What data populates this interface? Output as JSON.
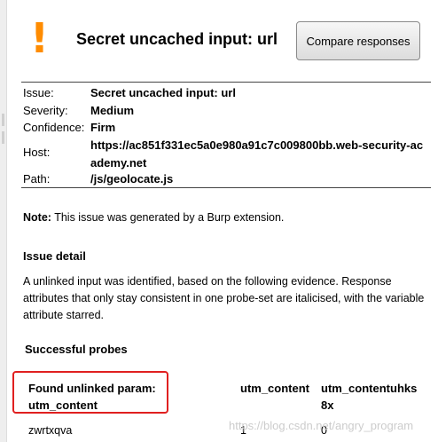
{
  "header": {
    "icon": "exclamation-warning-icon",
    "icon_glyph": "!",
    "icon_color": "#ff8c00",
    "title": "Secret uncached input: url",
    "compare_button": "Compare responses"
  },
  "issue_meta": [
    {
      "label": "Issue:",
      "value": "Secret uncached input: url"
    },
    {
      "label": "Severity:",
      "value": "Medium"
    },
    {
      "label": "Confidence:",
      "value": "Firm"
    },
    {
      "label": "Host:",
      "value": "https://ac851f331ec5a0e980a91c7c009800bb.web-security-academy.net"
    },
    {
      "label": "Path:",
      "value": "/js/geolocate.js"
    }
  ],
  "note": {
    "label": "Note:",
    "text": "This issue was generated by a Burp extension."
  },
  "issue_detail": {
    "heading": "Issue detail",
    "text": "A unlinked input was identified, based on the following evidence. Response attributes that only stay consistent in one probe-set are italicised, with the variable attribute starred."
  },
  "probes": {
    "heading": "Successful probes",
    "found_label": "Found unlinked param:",
    "found_value": "utm_content",
    "col1_header": "utm_content",
    "col2_header": "utm_contentuhks",
    "col2_value": "8x",
    "row_label": "zwrtxqva",
    "row_col1": "1",
    "row_col2": "0"
  },
  "watermark": "https://blog.csdn.net/angry_program"
}
